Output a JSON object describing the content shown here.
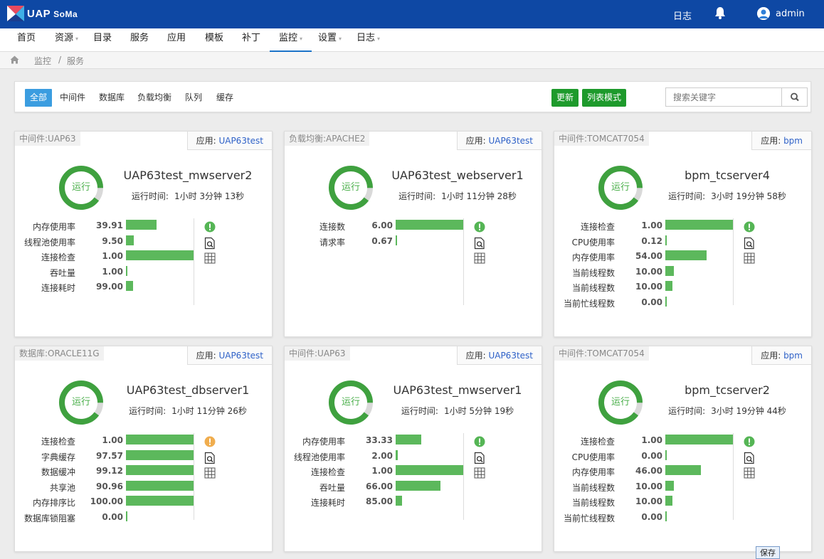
{
  "header": {
    "logo_text": "UAP",
    "logo_sub": "SoMa",
    "log_link": "日志",
    "user": "admin"
  },
  "nav": [
    {
      "label": "首页",
      "caret": false
    },
    {
      "label": "资源",
      "caret": true
    },
    {
      "label": "目录",
      "caret": false
    },
    {
      "label": "服务",
      "caret": false
    },
    {
      "label": "应用",
      "caret": false
    },
    {
      "label": "模板",
      "caret": false
    },
    {
      "label": "补丁",
      "caret": false
    },
    {
      "label": "监控",
      "caret": true,
      "active": true
    },
    {
      "label": "设置",
      "caret": true
    },
    {
      "label": "日志",
      "caret": true
    }
  ],
  "breadcrumb": {
    "level1": "监控",
    "separator": "/",
    "level2": "服务"
  },
  "filter": {
    "tabs": [
      "全部",
      "中间件",
      "数据库",
      "负载均衡",
      "队列",
      "缓存"
    ],
    "refresh_label": "更新",
    "list_mode_label": "列表模式",
    "search_placeholder": "搜索关键字"
  },
  "colors": {
    "topbar": "#0e48a4",
    "accent": "#3b9de0",
    "green_button": "#1e9a2c",
    "bar": "#5cb85c",
    "ring": "#3fa13f",
    "warn_ok": "#55b555",
    "warn_alert": "#f0ad4e",
    "link": "#2f62c8"
  },
  "cards": [
    {
      "type": "中间件:UAP63",
      "app_label": "应用:",
      "app_link": "UAP63test",
      "status": "运行",
      "name": "UAP63test_mwserver2",
      "uptime_label": "运行时间:",
      "uptime": "1小时 3分钟 13秒",
      "status_icon": "ok",
      "metrics": [
        {
          "name": "内存使用率",
          "value": "39.91",
          "level": 0.45
        },
        {
          "name": "线程池使用率",
          "value": "9.50",
          "level": 0.11
        },
        {
          "name": "连接检查",
          "value": "1.00",
          "level": 1.0
        },
        {
          "name": "吞吐量",
          "value": "1.00",
          "level": 0.02
        },
        {
          "name": "连接耗时",
          "value": "99.00",
          "level": 0.1
        }
      ]
    },
    {
      "type": "负载均衡:APACHE2",
      "app_label": "应用:",
      "app_link": "UAP63test",
      "status": "运行",
      "name": "UAP63test_webserver1",
      "uptime_label": "运行时间:",
      "uptime": "1小时 11分钟 28秒",
      "status_icon": "ok",
      "metrics": [
        {
          "name": "连接数",
          "value": "6.00",
          "level": 1.0
        },
        {
          "name": "请求率",
          "value": "0.67",
          "level": 0.02
        }
      ]
    },
    {
      "type": "中间件:TOMCAT7054",
      "app_label": "应用:",
      "app_link": "bpm",
      "status": "运行",
      "name": "bpm_tcserver4",
      "uptime_label": "运行时间:",
      "uptime": "3小时 19分钟 58秒",
      "status_icon": "ok",
      "metrics": [
        {
          "name": "连接检查",
          "value": "1.00",
          "level": 1.0
        },
        {
          "name": "CPU使用率",
          "value": "0.12",
          "level": 0.02
        },
        {
          "name": "内存使用率",
          "value": "54.00",
          "level": 0.6
        },
        {
          "name": "当前线程数",
          "value": "10.00",
          "level": 0.13
        },
        {
          "name": "当前线程数",
          "value": "10.00",
          "level": 0.1
        },
        {
          "name": "当前忙线程数",
          "value": "0.00",
          "level": 0.02
        }
      ]
    },
    {
      "type": "数据库:ORACLE11G",
      "app_label": "应用:",
      "app_link": "UAP63test",
      "status": "运行",
      "name": "UAP63test_dbserver1",
      "uptime_label": "运行时间:",
      "uptime": "1小时 11分钟 26秒",
      "status_icon": "warn",
      "metrics": [
        {
          "name": "连接检查",
          "value": "1.00",
          "level": 1.0
        },
        {
          "name": "字典缓存",
          "value": "97.57",
          "level": 1.0
        },
        {
          "name": "数据缓冲",
          "value": "99.12",
          "level": 1.0
        },
        {
          "name": "共享池",
          "value": "90.96",
          "level": 1.0
        },
        {
          "name": "内存排序比",
          "value": "100.00",
          "level": 1.0
        },
        {
          "name": "数据库锁阻塞",
          "value": "0.00",
          "level": 0.02
        }
      ]
    },
    {
      "type": "中间件:UAP63",
      "app_label": "应用:",
      "app_link": "UAP63test",
      "status": "运行",
      "name": "UAP63test_mwserver1",
      "uptime_label": "运行时间:",
      "uptime": "1小时 5分钟 19秒",
      "status_icon": "ok",
      "metrics": [
        {
          "name": "内存使用率",
          "value": "33.33",
          "level": 0.38
        },
        {
          "name": "线程池使用率",
          "value": "2.00",
          "level": 0.03
        },
        {
          "name": "连接检查",
          "value": "1.00",
          "level": 1.0
        },
        {
          "name": "吞吐量",
          "value": "66.00",
          "level": 0.66
        },
        {
          "name": "连接耗时",
          "value": "85.00",
          "level": 0.09
        }
      ]
    },
    {
      "type": "中间件:TOMCAT7054",
      "app_label": "应用:",
      "app_link": "bpm",
      "status": "运行",
      "name": "bpm_tcserver2",
      "uptime_label": "运行时间:",
      "uptime": "3小时 19分钟 44秒",
      "status_icon": "ok",
      "metrics": [
        {
          "name": "连接检查",
          "value": "1.00",
          "level": 1.0
        },
        {
          "name": "CPU使用率",
          "value": "0.00",
          "level": 0.02
        },
        {
          "name": "内存使用率",
          "value": "46.00",
          "level": 0.52
        },
        {
          "name": "当前线程数",
          "value": "10.00",
          "level": 0.13
        },
        {
          "name": "当前线程数",
          "value": "10.00",
          "level": 0.1
        },
        {
          "name": "当前忙线程数",
          "value": "0.00",
          "level": 0.02
        }
      ]
    }
  ],
  "save_tip": "保存"
}
